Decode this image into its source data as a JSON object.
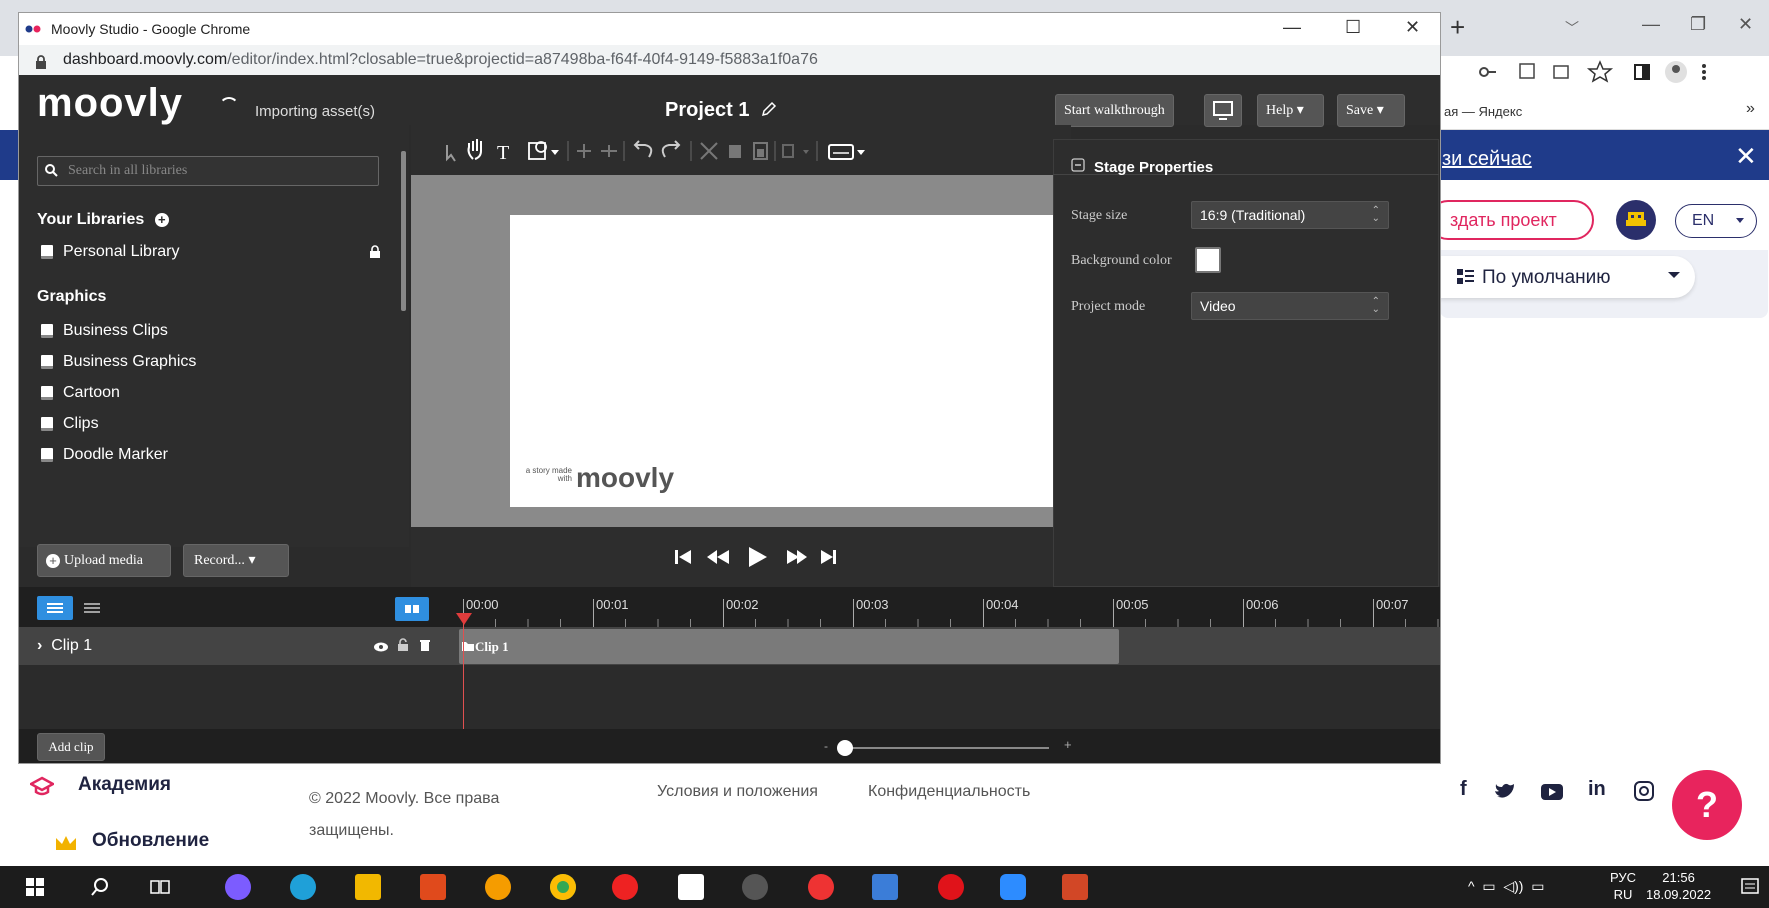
{
  "background_page": {
    "bookmark": "ая — Яндекс",
    "banner_link": "зи сейчас",
    "create_project": "здать проект",
    "language": "EN",
    "default_view": "По умолчанию",
    "sidebar_academy": "Академия",
    "sidebar_update": "Обновление",
    "copyright": "© 2022 Moovly. Все права защищены.",
    "terms": "Условия и положения",
    "privacy": "Конфиденциальность",
    "help_button": "?",
    "social": [
      "f",
      "t",
      "yt",
      "in",
      "ig"
    ]
  },
  "window": {
    "title": "Moovly Studio - Google Chrome",
    "url_host": "dashboard.moovly.com",
    "url_path": "/editor/index.html?closable=true&projectid=a87498ba-f64f-40f4-9149-f5883a1f0a76"
  },
  "header": {
    "logo": "moovly",
    "status": "Importing asset(s)",
    "project_title": "Project 1",
    "walkthrough": "Start walkthrough",
    "help": "Help",
    "save": "Save"
  },
  "library": {
    "search_placeholder": "Search in all libraries",
    "your_libraries": "Your Libraries",
    "personal": "Personal Library",
    "graphics": "Graphics",
    "graphics_items": [
      "Business Clips",
      "Business Graphics",
      "Cartoon",
      "Clips",
      "Doodle Marker"
    ],
    "upload": "Upload media",
    "record": "Record..."
  },
  "stage": {
    "watermark_small": "a story made with",
    "watermark_logo": "moovly"
  },
  "properties": {
    "title": "Stage Properties",
    "stage_size_label": "Stage size",
    "stage_size_value": "16:9 (Traditional)",
    "background_color_label": "Background color",
    "background_color": "#ffffff",
    "project_mode_label": "Project mode",
    "project_mode_value": "Video"
  },
  "timeline": {
    "ticks": [
      "00:00",
      "00:01",
      "00:02",
      "00:03",
      "00:04",
      "00:05",
      "00:06",
      "00:07"
    ],
    "track_name": "Clip 1",
    "clip_block": "Clip 1",
    "add_clip": "Add clip"
  },
  "taskbar": {
    "lang_top": "РУС",
    "lang_bottom": "RU",
    "time": "21:56",
    "date": "18.09.2022"
  },
  "colors": {
    "accent_blue": "#2f8fe0",
    "brand_pink": "#e8245d",
    "banner_blue": "#1f3b8a"
  }
}
